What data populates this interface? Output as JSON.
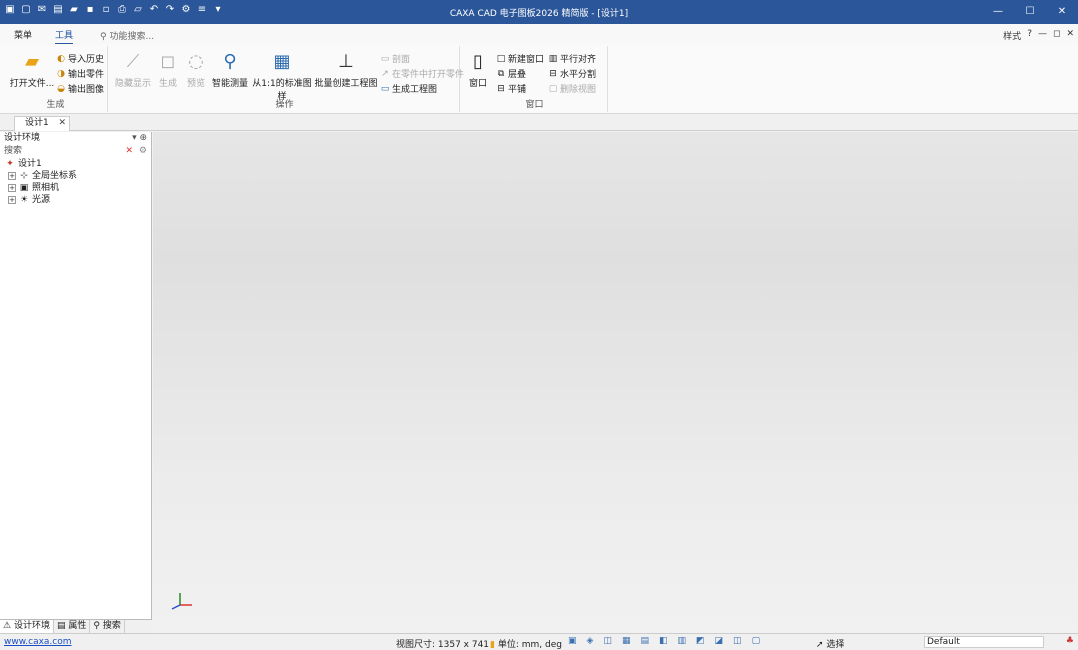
{
  "titlebar": {
    "title": "CAXA CAD 电子图板2026 精简版 - [设计1]",
    "quick_icons": [
      "app-icon",
      "new-icon",
      "mail-icon",
      "pdf-icon",
      "open-icon",
      "save-icon",
      "save-as-icon",
      "print-icon",
      "folder-icon",
      "undo-icon",
      "redo-icon",
      "settings-icon",
      "menu-icon",
      "more-icon"
    ],
    "minimize": "—",
    "maximize": "☐",
    "close": "✕"
  },
  "menubar": {
    "tabs": [
      {
        "label": "菜单"
      },
      {
        "label": "工具",
        "active": true
      }
    ],
    "search_placeholder": "功能搜索...",
    "style_label": "样式",
    "help": "?",
    "window_btns": [
      "—",
      "◻",
      "✕"
    ]
  },
  "ribbon": {
    "groups": [
      {
        "label": "生成",
        "buttons": [
          {
            "label": "打开文件...",
            "icon": "folder-open-icon"
          },
          {
            "label": "导入历史",
            "icon": "import-history-icon"
          },
          {
            "label": "输出零件",
            "icon": "export-part-icon"
          },
          {
            "label": "输出图像",
            "icon": "export-image-icon"
          }
        ]
      },
      {
        "label": "操作",
        "buttons": [
          {
            "label": "隐藏显示",
            "icon": "hide-show-icon",
            "disabled": true
          },
          {
            "label": "生成",
            "icon": "generate-icon",
            "disabled": true
          },
          {
            "label": "预览",
            "icon": "preview-icon",
            "disabled": true
          },
          {
            "label": "智能测量",
            "icon": "smart-measure-icon"
          },
          {
            "label": "从1:1的标准图样",
            "icon": "standard-drawing-icon"
          },
          {
            "label": "批量创建工程图",
            "icon": "batch-drawing-icon"
          },
          {
            "label": "剖面",
            "icon": "section-icon",
            "disabled": true
          },
          {
            "label": "在零件中打开零件",
            "icon": "open-part-icon",
            "disabled": true
          },
          {
            "label": "生成工程图",
            "icon": "drawing-icon"
          }
        ]
      },
      {
        "label": "窗口",
        "buttons": [
          {
            "label": "窗口",
            "icon": "window-icon"
          },
          {
            "label": "新建窗口",
            "icon": "new-window-icon"
          },
          {
            "label": "层叠",
            "icon": "cascade-icon"
          },
          {
            "label": "平铺",
            "icon": "tile-icon"
          },
          {
            "label": "平行对齐",
            "icon": "align-icon"
          },
          {
            "label": "水平分割",
            "icon": "split-icon"
          },
          {
            "label": "删除视图",
            "icon": "delete-view-icon",
            "disabled": true
          }
        ]
      }
    ]
  },
  "doc_tab": {
    "label": "设计1",
    "close": "✕"
  },
  "panel": {
    "title": "设计环境",
    "pin_symbols": "▾ ⊕",
    "search_label": "搜索",
    "tree": [
      {
        "label": "设计1",
        "icon": "design-icon",
        "expander": ""
      },
      {
        "label": "全局坐标系",
        "icon": "coordinate-icon",
        "expander": "+"
      },
      {
        "label": "照相机",
        "icon": "camera-icon",
        "expander": "+"
      },
      {
        "label": "光源",
        "icon": "light-icon",
        "expander": "+"
      }
    ],
    "tabs": [
      {
        "label": "设计环境",
        "icon": "design-env-icon",
        "active": true
      },
      {
        "label": "属性",
        "icon": "properties-icon"
      },
      {
        "label": "搜索",
        "icon": "search-icon"
      }
    ]
  },
  "statusbar": {
    "link": "www.caxa.com",
    "view_size": "视图尺寸: 1357 x 741",
    "units_label": "单位:",
    "units": "mm, deg",
    "select_label": "选择",
    "style_value": "Default",
    "status_icons": [
      "▣",
      "◈",
      "◫",
      "▦",
      "▤",
      "◧",
      "▥",
      "◩",
      "◪",
      "◫",
      "▢"
    ]
  }
}
